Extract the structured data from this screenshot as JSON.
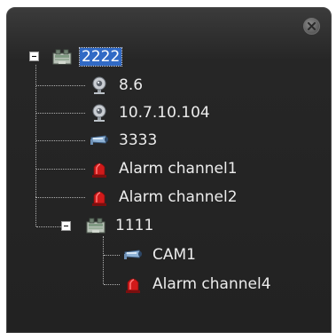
{
  "window": {
    "close_icon": "close-icon"
  },
  "tree": {
    "root": {
      "label": "2222",
      "icon": "device-group-icon",
      "expanded": true,
      "selected": true
    },
    "items": [
      {
        "label": "8.6",
        "icon": "dome-camera-icon"
      },
      {
        "label": "10.7.10.104",
        "icon": "dome-camera-icon"
      },
      {
        "label": "3333",
        "icon": "bullet-camera-icon"
      },
      {
        "label": "Alarm channel1",
        "icon": "alarm-siren-icon"
      },
      {
        "label": "Alarm channel2",
        "icon": "alarm-siren-icon"
      }
    ],
    "subgroup": {
      "label": "1111",
      "icon": "device-group-icon",
      "expanded": true,
      "items": [
        {
          "label": "CAM1",
          "icon": "bullet-camera-icon"
        },
        {
          "label": "Alarm channel4",
          "icon": "alarm-siren-icon"
        }
      ]
    }
  },
  "colors": {
    "selection": "#316ac5",
    "background": "#262626",
    "text": "#ececec",
    "alarm": "#d11a1a"
  }
}
